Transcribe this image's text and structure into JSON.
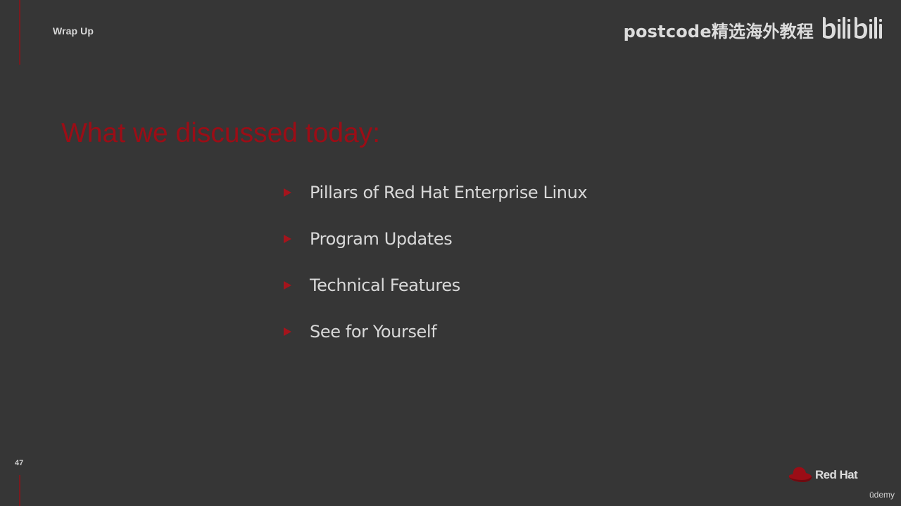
{
  "header": {
    "section_label": "Wrap Up",
    "watermark_text": "postcode精选海外教程",
    "watermark_logo": "bilibili"
  },
  "slide": {
    "title": "What we discussed today:",
    "bullets": [
      "Pillars of Red Hat Enterprise Linux",
      "Program Updates",
      "Technical Features",
      "See for Yourself"
    ],
    "page_number": "47"
  },
  "footer": {
    "brand_logo": "Red Hat",
    "platform_mark": "ūdemy"
  },
  "colors": {
    "background": "#363636",
    "accent_red": "#9b0d16",
    "text": "#d9d9d9"
  },
  "icons": {
    "bullet_marker": "triangle-right-icon",
    "brand_icon": "red-hat-icon"
  }
}
